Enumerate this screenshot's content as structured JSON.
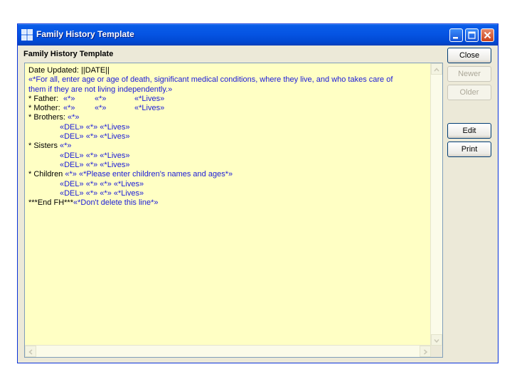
{
  "window": {
    "title": "Family History Template",
    "header_label": "Family History Template"
  },
  "buttons": {
    "close": "Close",
    "newer": "Newer",
    "older": "Older",
    "edit": "Edit",
    "print": "Print"
  },
  "template": {
    "date_updated": "Date Updated: ||DATE||",
    "instruction_line1": "«*For all, enter age or age of death, significant medical conditions, where they live, and who takes care of",
    "instruction_line2": "them if they are not living independently.»",
    "father_label": "* Father:",
    "mother_label": "* Mother:",
    "brothers_label": "* Brothers:",
    "sisters_label": "* Sisters",
    "children_label": "* Children",
    "field": "«*»",
    "lives": "«*Lives»",
    "del": "«DEL»",
    "children_prompt": "«*Please enter children's names and ages*»",
    "end_line_black": "***End FH***",
    "end_line_blue": "«*Don't delete this line*»"
  },
  "colors": {
    "titlebar": "#0554e3",
    "field_text": "#1b1bd8",
    "text_background": "#ffffc4",
    "window_face": "#ece9d8"
  },
  "icons": {
    "app": "grid-app-icon",
    "minimize": "minimize-icon",
    "maximize": "maximize-icon",
    "close": "close-icon"
  }
}
